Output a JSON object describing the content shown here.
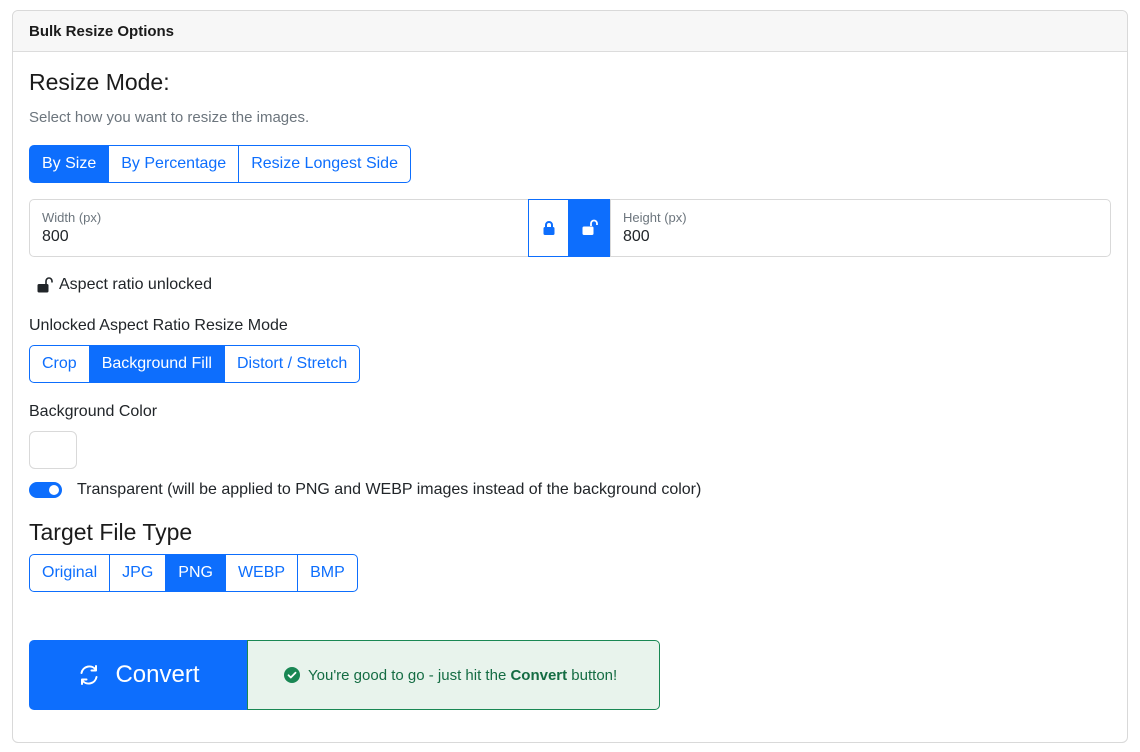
{
  "header": {
    "title": "Bulk Resize Options"
  },
  "resize_mode": {
    "title": "Resize Mode:",
    "subtitle": "Select how you want to resize the images.",
    "options": [
      "By Size",
      "By Percentage",
      "Resize Longest Side"
    ],
    "selected": "By Size"
  },
  "dimensions": {
    "width_label": "Width (px)",
    "width_value": "800",
    "height_label": "Height (px)",
    "height_value": "800",
    "lock_icon": "lock-icon",
    "unlock_icon": "unlock-icon"
  },
  "aspect_status": "Aspect ratio unlocked",
  "unlocked_mode": {
    "label": "Unlocked Aspect Ratio Resize Mode",
    "options": [
      "Crop",
      "Background Fill",
      "Distort / Stretch"
    ],
    "selected": "Background Fill"
  },
  "background": {
    "label": "Background Color",
    "color": "#ffffff",
    "transparent_label": "Transparent (will be applied to PNG and WEBP images instead of the background color)",
    "transparent_enabled": true
  },
  "target_type": {
    "title": "Target File Type",
    "options": [
      "Original",
      "JPG",
      "PNG",
      "WEBP",
      "BMP"
    ],
    "selected": "PNG"
  },
  "convert": {
    "button_label": "Convert",
    "status_prefix": "You're good to go - just hit the ",
    "status_bold": "Convert",
    "status_suffix": " button!"
  },
  "colors": {
    "accent": "#0d6efd",
    "success": "#198754"
  }
}
